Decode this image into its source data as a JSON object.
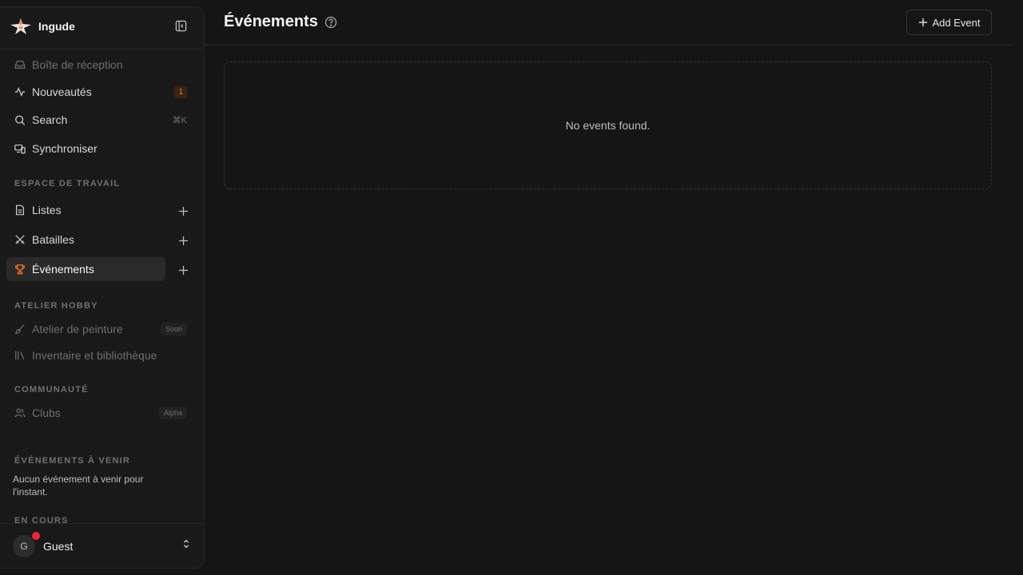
{
  "app": {
    "name": "Ingude",
    "accent": "#f97316"
  },
  "nav": {
    "inbox": "Boîte de réception",
    "news": "Nouveautés",
    "news_count": "1",
    "search": "Search",
    "search_shortcut": "⌘K",
    "sync": "Synchroniser"
  },
  "workspace": {
    "label": "ESPACE DE TRAVAIL",
    "lists": "Listes",
    "battles": "Batailles",
    "events": "Événements"
  },
  "hobby": {
    "label": "ATELIER HOBBY",
    "paint": "Atelier de peinture",
    "paint_tag": "Soon",
    "inventory": "Inventaire et bibliothèque"
  },
  "community": {
    "label": "COMMUNAUTÉ",
    "clubs": "Clubs",
    "clubs_tag": "Alpha"
  },
  "upcoming": {
    "label": "ÉVÉNEMENTS À VENIR",
    "empty": "Aucun événement à venir pour l'instant."
  },
  "ongoing": {
    "label": "EN COURS"
  },
  "user": {
    "initial": "G",
    "name": "Guest"
  },
  "main": {
    "title": "Événements",
    "add_label": "Add Event",
    "empty": "No events found."
  }
}
